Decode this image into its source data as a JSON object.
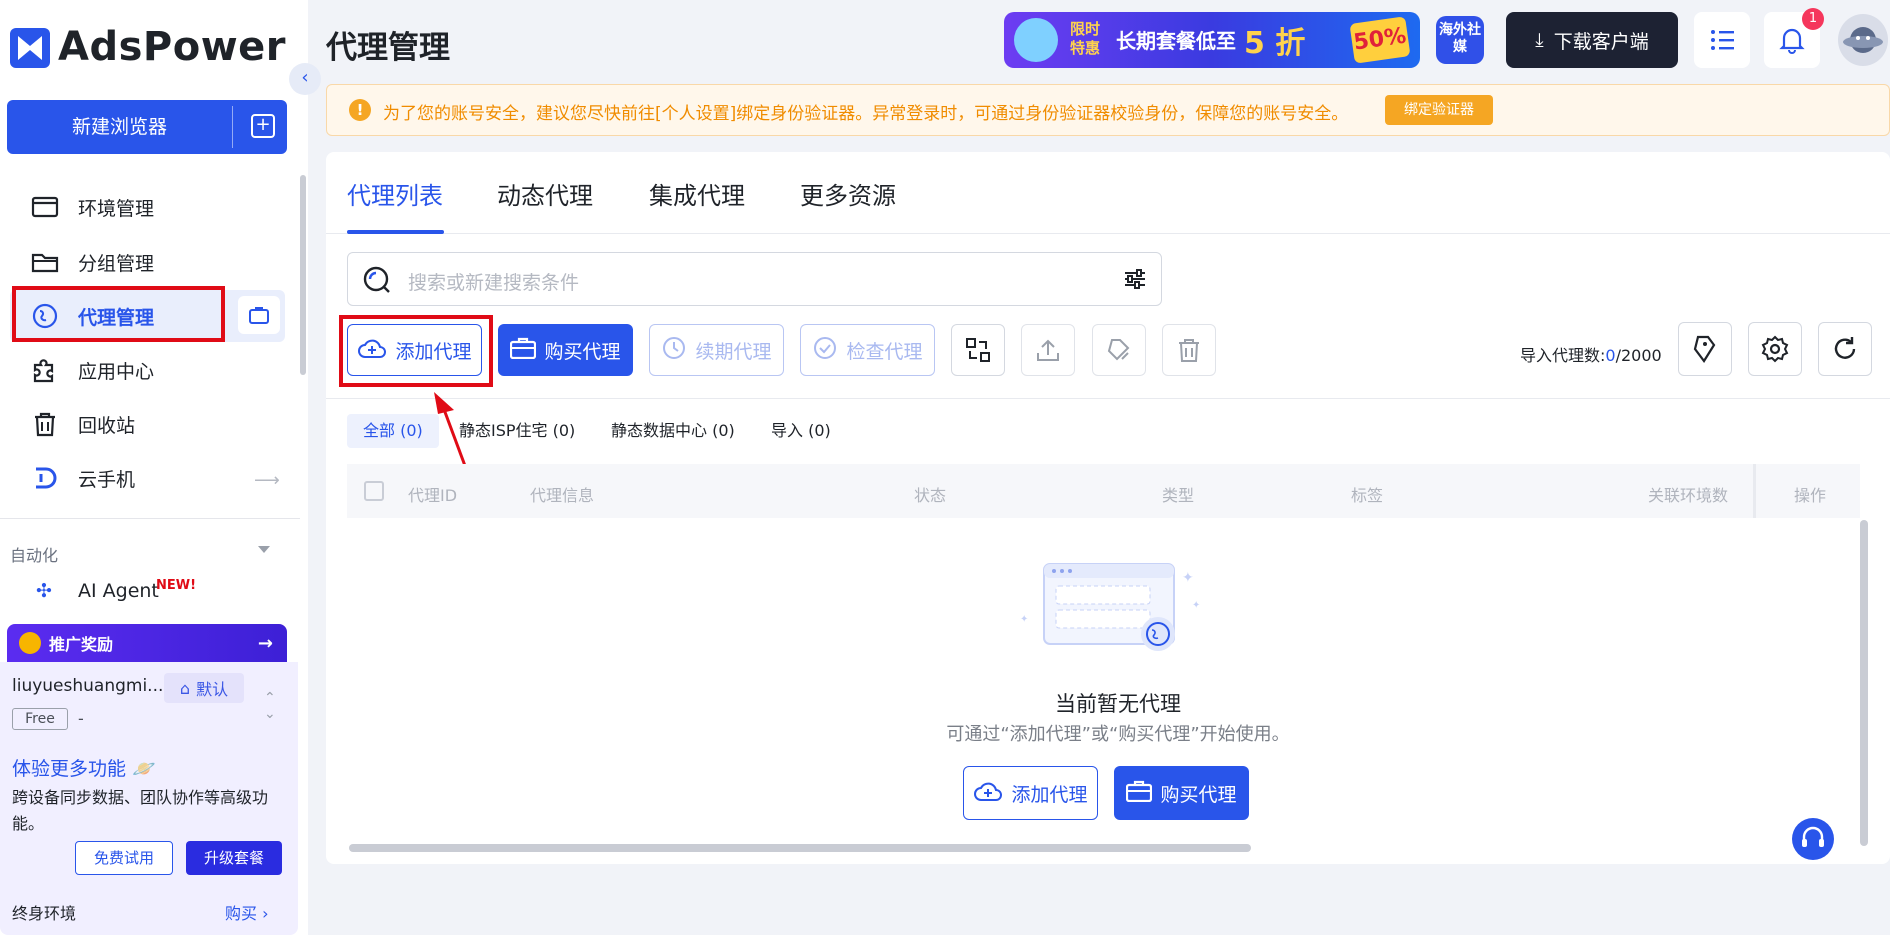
{
  "sidebar": {
    "logo_text": "AdsPower",
    "new_browser_label": "新建浏览器",
    "items": [
      {
        "label": "环境管理",
        "icon": "browser-window-icon"
      },
      {
        "label": "分组管理",
        "icon": "folder-icon"
      },
      {
        "label": "代理管理",
        "icon": "proxy-globe-icon",
        "active": true
      },
      {
        "label": "应用中心",
        "icon": "puzzle-icon"
      },
      {
        "label": "回收站",
        "icon": "trash-icon"
      },
      {
        "label": "云手机",
        "icon": "cloud-phone-icon"
      }
    ],
    "automation_label": "自动化",
    "ai_agent_label": "AI Agent",
    "new_tag": "NEW!",
    "promo_label": "推广奖励",
    "user": {
      "name": "liuyueshuangmi...",
      "default_label": "默认",
      "plan": "Free",
      "plan_extra": "-"
    },
    "experience": {
      "title": "体验更多功能",
      "desc": "跨设备同步数据、团队协作等高级功能。",
      "trial_label": "免费试用",
      "upgrade_label": "升级套餐"
    },
    "lifetime_label": "终身环境",
    "buy_label": "购买"
  },
  "header": {
    "title": "代理管理",
    "banner": {
      "tag_line1": "限时",
      "tag_line2": "特惠",
      "text": "长期套餐低至",
      "highlight": "5 折",
      "badge": "50%"
    },
    "overseas_label": "海外社媒",
    "download_label": "下载客户端",
    "notification_count": "1"
  },
  "alert": {
    "text": "为了您的账号安全，建议您尽快前往[个人设置]绑定身份验证器。异常登录时，可通过身份验证器校验身份，保障您的账号安全。",
    "button": "绑定验证器"
  },
  "main": {
    "tabs": [
      "代理列表",
      "动态代理",
      "集成代理",
      "更多资源"
    ],
    "search_placeholder": "搜索或新建搜索条件",
    "toolbar": {
      "add_proxy": "添加代理",
      "buy_proxy": "购买代理",
      "renew_proxy": "续期代理",
      "check_proxy": "检查代理"
    },
    "import_count_label": "导入代理数:",
    "import_count_used": "0",
    "import_count_total": "/2000",
    "filter_tabs": [
      "全部 (0)",
      "静态ISP住宅 (0)",
      "静态数据中心 (0)",
      "导入 (0)"
    ],
    "columns": [
      "代理ID",
      "代理信息",
      "状态",
      "类型",
      "标签",
      "关联环境数",
      "操作"
    ],
    "empty": {
      "title": "当前暂无代理",
      "desc": "可通过“添加代理”或“购买代理”开始使用。",
      "add_label": "添加代理",
      "buy_label": "购买代理"
    }
  },
  "colors": {
    "accent": "#2955ea",
    "highlight_frame": "#e00b16",
    "alert_text": "#f08c00"
  }
}
